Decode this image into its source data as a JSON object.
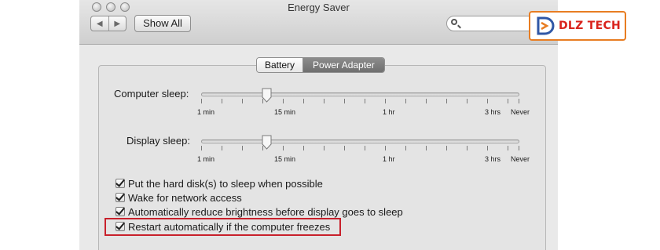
{
  "window": {
    "title": "Energy Saver"
  },
  "toolbar": {
    "back_icon": "back-arrow-icon",
    "forward_icon": "forward-arrow-icon",
    "show_all_label": "Show All",
    "search": {
      "placeholder": "",
      "value": ""
    }
  },
  "tabs": {
    "items": [
      {
        "label": "Battery",
        "selected": false
      },
      {
        "label": "Power Adapter",
        "selected": true
      }
    ]
  },
  "sliders": [
    {
      "label": "Computer sleep:",
      "value": "15 min",
      "ticks": [
        "1 min",
        "15 min",
        "1 hr",
        "3 hrs",
        "Never"
      ]
    },
    {
      "label": "Display sleep:",
      "value": "15 min",
      "ticks": [
        "1 min",
        "15 min",
        "1 hr",
        "3 hrs",
        "Never"
      ]
    }
  ],
  "options": [
    {
      "label": "Put the hard disk(s) to sleep when possible",
      "checked": true
    },
    {
      "label": "Wake for network access",
      "checked": true
    },
    {
      "label": "Automatically reduce brightness before display goes to sleep",
      "checked": true
    },
    {
      "label": "Restart automatically if the computer freezes",
      "checked": true,
      "highlighted": true
    }
  ],
  "highlight_color": "#c8202b",
  "watermark": {
    "text": "DLZ TECH",
    "accent_color": "#e87d22",
    "text_color": "#d9231c"
  }
}
